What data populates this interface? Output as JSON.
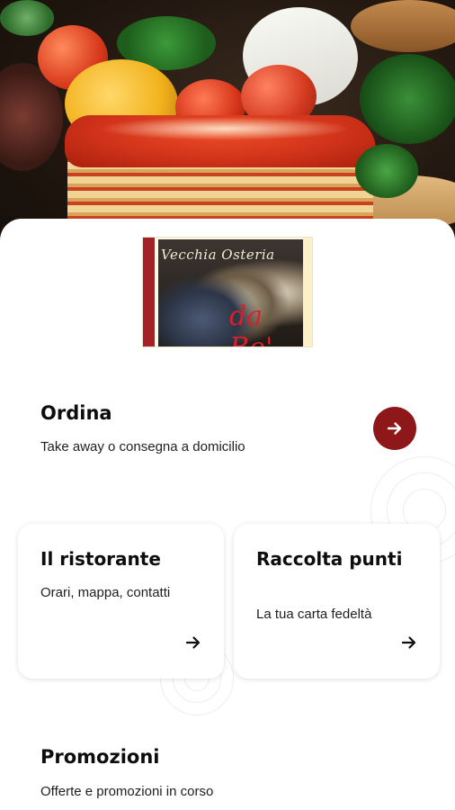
{
  "hero": {
    "description_icon": "food-photo"
  },
  "logo": {
    "line1": "Vecchia Osteria",
    "line2": "da Bo'"
  },
  "order": {
    "title": "Ordina",
    "subtitle": "Take away o consegna a domicilio",
    "icon": "arrow-right-icon",
    "accent": "#8d1719"
  },
  "cards": [
    {
      "title": "Il ristorante",
      "subtitle": "Orari, mappa, contatti",
      "icon": "arrow-right-icon"
    },
    {
      "title": "Raccolta punti",
      "subtitle": "La tua carta fedeltà",
      "icon": "arrow-right-icon"
    }
  ],
  "promo": {
    "title": "Promozioni",
    "subtitle": "Offerte e promozioni in corso"
  }
}
